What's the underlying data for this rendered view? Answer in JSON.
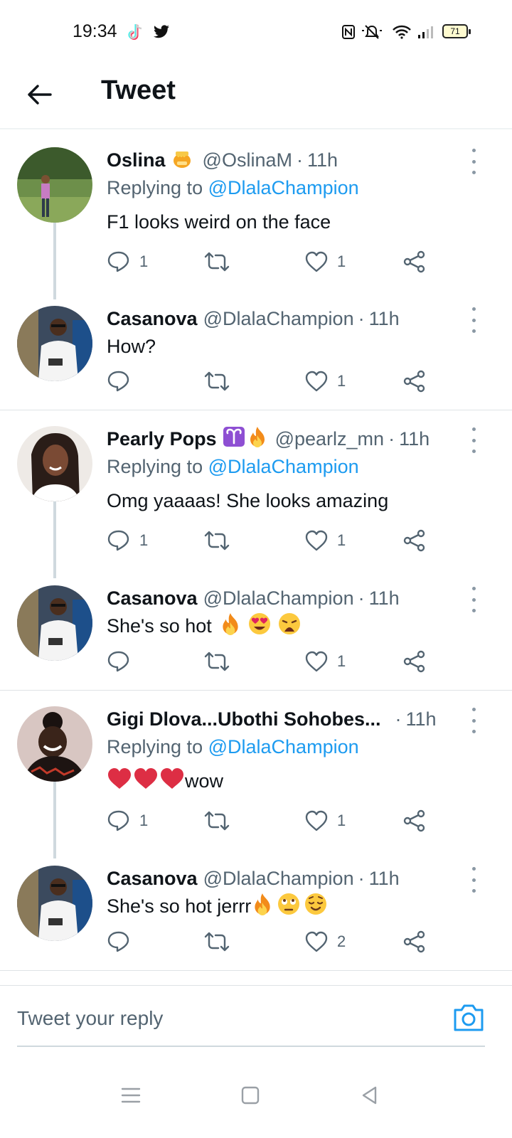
{
  "status_bar": {
    "time": "19:34",
    "battery": "71"
  },
  "header": {
    "title": "Tweet"
  },
  "threads": [
    {
      "parent": {
        "name": "Oslina",
        "handle": "@OslinaM",
        "time": "11h",
        "replying_label": "Replying to",
        "replying_to": "@DlalaChampion",
        "text": "F1 looks weird on the face",
        "replies": "1",
        "likes": "1"
      },
      "reply": {
        "name": "Casanova",
        "handle": "@DlalaChampion",
        "time": "11h",
        "text": "How?",
        "likes": "1"
      }
    },
    {
      "parent": {
        "name": "Pearly Pops",
        "handle": "@pearlz_mn",
        "time": "11h",
        "replying_label": "Replying to",
        "replying_to": "@DlalaChampion",
        "text": "Omg yaaaas! She looks amazing",
        "replies": "1",
        "likes": "1"
      },
      "reply": {
        "name": "Casanova",
        "handle": "@DlalaChampion",
        "time": "11h",
        "text": "She's so hot",
        "likes": "1"
      }
    },
    {
      "parent": {
        "name": "Gigi Dlova...Ubothi Sohobes...",
        "time": "11h",
        "replying_label": "Replying to",
        "replying_to": "@DlalaChampion",
        "text": "wow",
        "replies": "1",
        "likes": "1"
      },
      "reply": {
        "name": "Casanova",
        "handle": "@DlalaChampion",
        "time": "11h",
        "text": "She's so hot jerrr",
        "likes": "2"
      }
    }
  ],
  "composer": {
    "placeholder": "Tweet your reply"
  },
  "colors": {
    "accent": "#1d9bf0",
    "secondary_text": "#536471",
    "primary_text": "#0f1419",
    "like_heart": "#e0245e"
  }
}
